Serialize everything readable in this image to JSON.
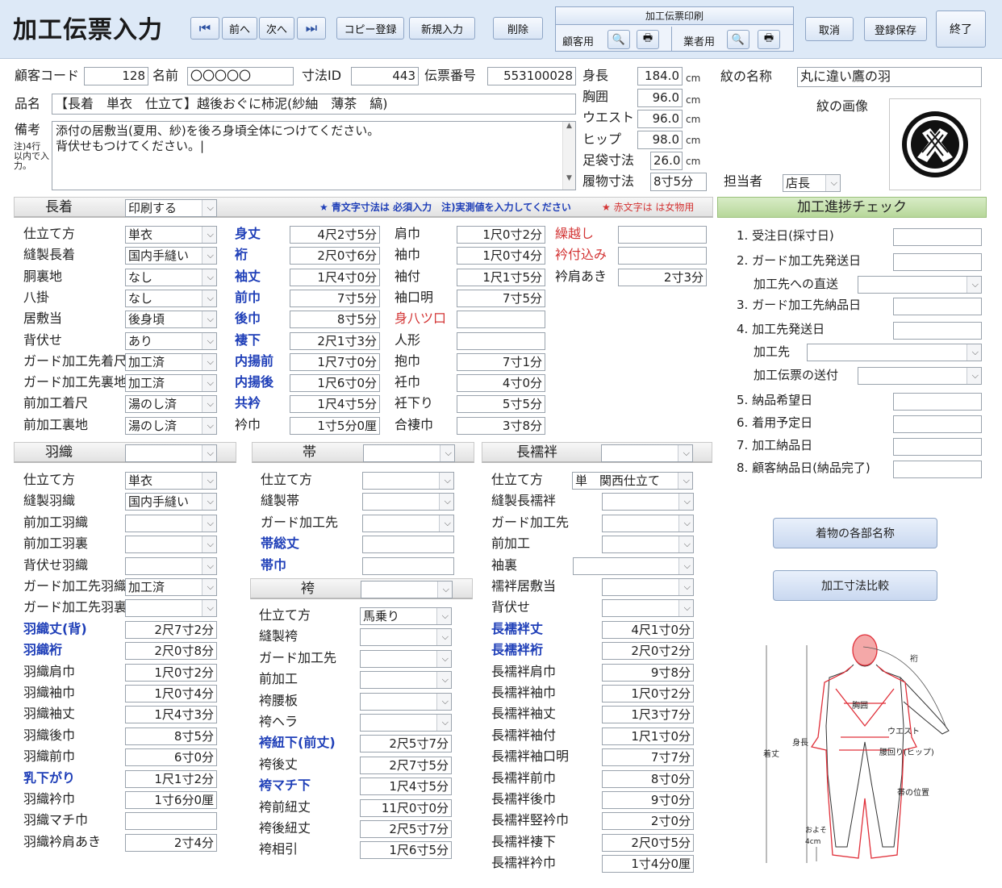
{
  "header": {
    "title": "加工伝票入力",
    "prev": "前へ",
    "next": "次へ",
    "copy": "コピー登録",
    "new": "新規入力",
    "delete": "削除",
    "print_title": "加工伝票印刷",
    "customer": "顧客用",
    "vendor": "業者用",
    "cancel": "取消",
    "save": "登録保存",
    "exit": "終了"
  },
  "info": {
    "customer_code_label": "顧客コード",
    "customer_code": "128",
    "name_label": "名前",
    "name": "〇〇〇〇〇",
    "size_id_label": "寸法ID",
    "size_id": "443",
    "slip_label": "伝票番号",
    "slip": "553100028",
    "product_label": "品名",
    "product": "【長着　単衣　仕立て】越後おぐに柿泥(紗紬　薄茶　縞)",
    "remark_label": "備考",
    "remark_note": "注)4行以内で入力。",
    "remark": "添付の居敷当(夏用、紗)を後ろ身頃全体につけてください。\n背伏せもつけてください。|",
    "height_label": "身長",
    "height": "184.0",
    "chest_label": "胸囲",
    "chest": "96.0",
    "waist_label": "ウエスト",
    "waist": "96.0",
    "hip_label": "ヒップ",
    "hip": "98.0",
    "tabi_label": "足袋寸法",
    "tabi": "26.0",
    "shoe_label": "履物寸法",
    "shoe": "8寸5分",
    "unit": "cm",
    "crest_name_label": "紋の名称",
    "crest_name": "丸に違い鷹の羽",
    "crest_image_label": "紋の画像",
    "staff_label": "担当者",
    "staff": "店長"
  },
  "nagagi": {
    "title": "長着",
    "print": "印刷する",
    "note_blue": "★ 青文字寸法は 必須入力　注)実測値を入力してください",
    "note_red": "★ 赤文字は は女物用",
    "col1": [
      {
        "l": "仕立て方",
        "v": "単衣"
      },
      {
        "l": "縫製長着",
        "v": "国内手縫い"
      },
      {
        "l": "胴裏地",
        "v": "なし"
      },
      {
        "l": "八掛",
        "v": "なし"
      },
      {
        "l": "居敷当",
        "v": "後身頃"
      },
      {
        "l": "背伏せ",
        "v": "あり"
      },
      {
        "l": "ガード加工先着尺",
        "v": "加工済"
      },
      {
        "l": "ガード加工先裏地",
        "v": "加工済"
      },
      {
        "l": "前加工着尺",
        "v": "湯のし済"
      },
      {
        "l": "前加工裏地",
        "v": "湯のし済"
      }
    ],
    "col2": [
      {
        "l": "身丈",
        "v": "4尺2寸5分"
      },
      {
        "l": "裄",
        "v": "2尺0寸6分"
      },
      {
        "l": "袖丈",
        "v": "1尺4寸0分"
      },
      {
        "l": "前巾",
        "v": "7寸5分"
      },
      {
        "l": "後巾",
        "v": "8寸5分"
      },
      {
        "l": "褄下",
        "v": "2尺1寸3分"
      },
      {
        "l": "内揚前",
        "v": "1尺7寸0分"
      },
      {
        "l": "内揚後",
        "v": "1尺6寸0分"
      },
      {
        "l": "共衿",
        "v": "1尺4寸5分"
      },
      {
        "l": "衿巾",
        "v": "1寸5分0厘"
      }
    ],
    "col3": [
      {
        "l": "肩巾",
        "v": "1尺0寸2分"
      },
      {
        "l": "袖巾",
        "v": "1尺0寸4分"
      },
      {
        "l": "袖付",
        "v": "1尺1寸5分"
      },
      {
        "l": "袖口明",
        "v": "7寸5分"
      },
      {
        "l": "身八ツ口",
        "v": ""
      },
      {
        "l": "人形",
        "v": ""
      },
      {
        "l": "抱巾",
        "v": "7寸1分"
      },
      {
        "l": "衽巾",
        "v": "4寸0分"
      },
      {
        "l": "衽下り",
        "v": "5寸5分"
      },
      {
        "l": "合褄巾",
        "v": "3寸8分"
      }
    ],
    "col4": [
      {
        "l": "繰越し",
        "v": ""
      },
      {
        "l": "衿付込み",
        "v": ""
      },
      {
        "l": "衿肩あき",
        "v": "2寸3分"
      }
    ]
  },
  "progress": {
    "title": "加工進捗チェック",
    "items": [
      "1. 受注日(採寸日)",
      "2. ガード加工先発送日",
      "加工先への直送",
      "3. ガード加工先納品日",
      "4. 加工先発送日",
      "加工先",
      "加工伝票の送付",
      "5. 納品希望日",
      "6. 着用予定日",
      "7. 加工納品日",
      "8. 顧客納品日(納品完了)"
    ],
    "btn_parts": "着物の各部名称",
    "btn_compare": "加工寸法比較"
  },
  "haori": {
    "title": "羽織",
    "rows": [
      {
        "l": "仕立て方",
        "v": "単衣"
      },
      {
        "l": "縫製羽織",
        "v": "国内手縫い"
      },
      {
        "l": "前加工羽織",
        "v": ""
      },
      {
        "l": "前加工羽裏",
        "v": ""
      },
      {
        "l": "背伏せ羽織",
        "v": ""
      },
      {
        "l": "ガード加工先羽織",
        "v": "加工済"
      },
      {
        "l": "ガード加工先羽裏",
        "v": ""
      },
      {
        "l": "羽織丈(背)",
        "v": "2尺7寸2分"
      },
      {
        "l": "羽織裄",
        "v": "2尺0寸8分"
      },
      {
        "l": "羽織肩巾",
        "v": "1尺0寸2分"
      },
      {
        "l": "羽織袖巾",
        "v": "1尺0寸4分"
      },
      {
        "l": "羽織袖丈",
        "v": "1尺4寸3分"
      },
      {
        "l": "羽織後巾",
        "v": "8寸5分"
      },
      {
        "l": "羽織前巾",
        "v": "6寸0分"
      },
      {
        "l": "乳下がり",
        "v": "1尺1寸2分"
      },
      {
        "l": "羽織衿巾",
        "v": "1寸6分0厘"
      },
      {
        "l": "羽織マチ巾",
        "v": ""
      },
      {
        "l": "羽織衿肩あき",
        "v": "2寸4分"
      }
    ]
  },
  "obi": {
    "title": "帯",
    "rows": [
      {
        "l": "仕立て方",
        "v": ""
      },
      {
        "l": "縫製帯",
        "v": ""
      },
      {
        "l": "ガード加工先",
        "v": ""
      },
      {
        "l": "帯総丈",
        "v": ""
      },
      {
        "l": "帯巾",
        "v": ""
      }
    ]
  },
  "hakama": {
    "title": "袴",
    "rows": [
      {
        "l": "仕立て方",
        "v": "馬乗り"
      },
      {
        "l": "縫製袴",
        "v": ""
      },
      {
        "l": "ガード加工先",
        "v": ""
      },
      {
        "l": "前加工",
        "v": ""
      },
      {
        "l": "袴腰板",
        "v": ""
      },
      {
        "l": "袴ヘラ",
        "v": ""
      },
      {
        "l": "袴紐下(前丈)",
        "v": "2尺5寸7分"
      },
      {
        "l": "袴後丈",
        "v": "2尺7寸5分"
      },
      {
        "l": "袴マチ下",
        "v": "1尺4寸5分"
      },
      {
        "l": "袴前紐丈",
        "v": "11尺0寸0分"
      },
      {
        "l": "袴後紐丈",
        "v": "2尺5寸7分"
      },
      {
        "l": "袴相引",
        "v": "1尺6寸5分"
      }
    ]
  },
  "juban": {
    "title": "長襦袢",
    "rows": [
      {
        "l": "仕立て方",
        "v": "単　関西仕立て"
      },
      {
        "l": "縫製長襦袢",
        "v": ""
      },
      {
        "l": "ガード加工先",
        "v": ""
      },
      {
        "l": "前加工",
        "v": ""
      },
      {
        "l": "袖裏",
        "v": ""
      },
      {
        "l": "襦袢居敷当",
        "v": ""
      },
      {
        "l": "背伏せ",
        "v": ""
      },
      {
        "l": "長襦袢丈",
        "v": "4尺1寸0分"
      },
      {
        "l": "長襦袢裄",
        "v": "2尺0寸2分"
      },
      {
        "l": "長襦袢肩巾",
        "v": "9寸8分"
      },
      {
        "l": "長襦袢袖巾",
        "v": "1尺0寸2分"
      },
      {
        "l": "長襦袢袖丈",
        "v": "1尺3寸7分"
      },
      {
        "l": "長襦袢袖付",
        "v": "1尺1寸0分"
      },
      {
        "l": "長襦袢袖口明",
        "v": "7寸7分"
      },
      {
        "l": "長襦袢前巾",
        "v": "8寸0分"
      },
      {
        "l": "長襦袢後巾",
        "v": "9寸0分"
      },
      {
        "l": "長襦袢竪衿巾",
        "v": "2寸0分"
      },
      {
        "l": "長襦袢褄下",
        "v": "2尺0寸5分"
      },
      {
        "l": "長襦袢衿巾",
        "v": "1寸4分0厘"
      }
    ]
  },
  "diagram": {
    "yuki": "裄",
    "kyoui": "胸囲",
    "waist": "ウエスト",
    "shincho": "身長",
    "kitake": "着丈",
    "hip": "腰回り(ヒップ)",
    "obi": "帯の位置",
    "oyoso": "およそ",
    "cm4": "4cm"
  }
}
